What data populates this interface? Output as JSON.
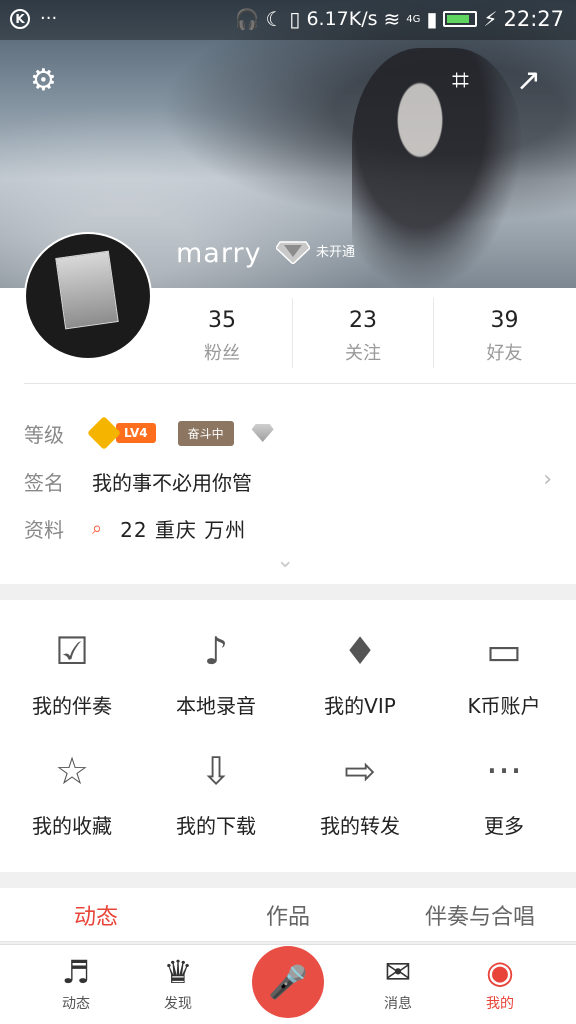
{
  "statusbar": {
    "left_logo": "K",
    "dots": "···",
    "speed": "6.17K/s",
    "network": "4G",
    "time": "22:27"
  },
  "header": {
    "username": "marry",
    "vip_status": "未开通"
  },
  "stats": [
    {
      "value": "35",
      "label": "粉丝"
    },
    {
      "value": "23",
      "label": "关注"
    },
    {
      "value": "39",
      "label": "好友"
    }
  ],
  "profile": {
    "level_label": "等级",
    "level_badge": "LV4",
    "level_tag": "奋斗中",
    "sign_label": "签名",
    "sign_text": "我的事不必用你管",
    "data_label": "资料",
    "data_text": "22 重庆 万州"
  },
  "grid": [
    {
      "label": "我的伴奏"
    },
    {
      "label": "本地录音"
    },
    {
      "label": "我的VIP"
    },
    {
      "label": "K币账户"
    },
    {
      "label": "我的收藏"
    },
    {
      "label": "我的下载"
    },
    {
      "label": "我的转发"
    },
    {
      "label": "更多"
    }
  ],
  "tabs": [
    {
      "label": "动态"
    },
    {
      "label": "作品"
    },
    {
      "label": "伴奏与合唱"
    }
  ],
  "nav": [
    {
      "label": "动态"
    },
    {
      "label": "发现"
    },
    {
      "label": "消息"
    },
    {
      "label": "我的"
    }
  ],
  "colors": {
    "accent": "#e8443a",
    "record": "#e94e45",
    "level_orange": "#ff6e1d"
  }
}
